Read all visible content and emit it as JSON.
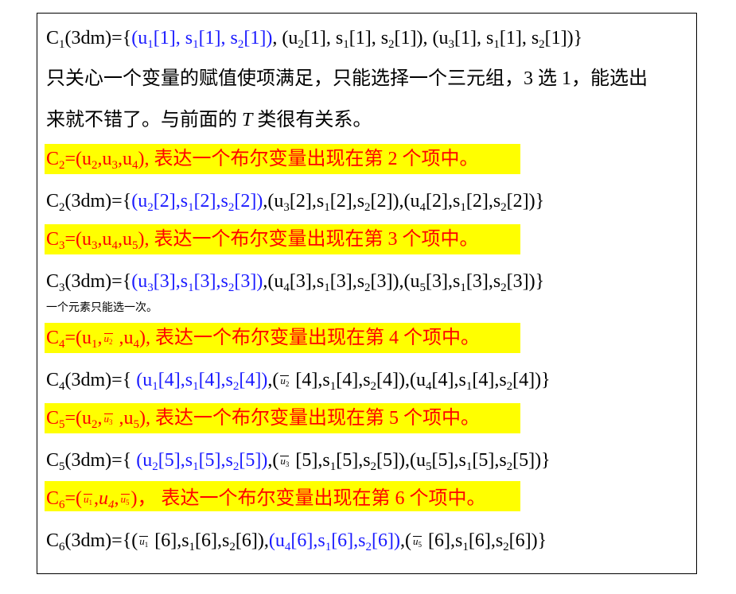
{
  "lines": {
    "l1": {
      "p0": "C",
      "s0": "1",
      "p1": "(3dm)={",
      "b1": "(u",
      "bs1": "1",
      "b2": "[1], s",
      "bs2": "1",
      "b3": "[1], s",
      "bs3": "2",
      "b4": "[1])",
      "p2": ", (u",
      "s1": "2",
      "p3": "[1], s",
      "s2": "1",
      "p4": "[1], s",
      "s3": "2",
      "p5": "[1]), (u",
      "s4": "3",
      "p6": "[1], s",
      "s5": "1",
      "p7": "[1], s",
      "s6": "2",
      "p8": "[1])}"
    },
    "l2": "只关心一个变量的赋值使项满足，只能选择一个三元组，3 选 1，能选出",
    "l3": {
      "a": "来就不错了。与前面的 ",
      "t": "T",
      "b": " 类很有关系。"
    },
    "h2": {
      "a": "C",
      "s0": "2",
      "b": "=(u",
      "s1": "2",
      "c": ",u",
      "s2": "3",
      "d": ",u",
      "s3": "4",
      "e": "),  表达一个布尔变量出现在第 2 个项中。"
    },
    "c2": {
      "a": "C",
      "s0": "2",
      "b": "(3dm)={",
      "b1": "(u",
      "bs1": "2",
      "b2": "[2],s",
      "bs2": "1",
      "b3": "[2],s",
      "bs3": "2",
      "b4": "[2])",
      "c": ",(u",
      "s1": "3",
      "d": "[2],s",
      "s2": "1",
      "e": "[2],s",
      "s3": "2",
      "f": "[2]),(u",
      "s4": "4",
      "g": "[2],s",
      "s5": "1",
      "h": "[2],s",
      "s6": "2",
      "i": "[2])}"
    },
    "h3": {
      "a": "C",
      "s0": "3",
      "b": "=(u",
      "s1": "3",
      "c": ",u",
      "s2": "4",
      "d": ",u",
      "s3": "5",
      "e": "),  表达一个布尔变量出现在第 3 个项中。"
    },
    "c3": {
      "a": "C",
      "s0": "3",
      "b": "(3dm)={",
      "b1": "(u",
      "bs1": "3",
      "b2": "[3],s",
      "bs2": "1",
      "b3": "[3],s",
      "bs3": "2",
      "b4": "[3])",
      "c": ",(u",
      "s1": "4",
      "d": "[3],s",
      "s2": "1",
      "e": "[3],s",
      "s3": "2",
      "f": "[3]),(u",
      "s4": "5",
      "g": "[3],s",
      "s5": "1",
      "h": "[3],s",
      "s6": "2",
      "i": "[3])}"
    },
    "note": "一个元素只能选一次。",
    "h4": {
      "a": "C",
      "s0": "4",
      "b": "=(u",
      "s1": "1",
      "c": ",",
      "u": "u",
      "us": "2",
      "d": " ,u",
      "s3": "4",
      "e": "),  表达一个布尔变量出现在第 4 个项中。"
    },
    "c4": {
      "a": "C",
      "s0": "4",
      "b": "(3dm)={ ",
      "b1": "(u",
      "bs1": "1",
      "b2": "[4],s",
      "bs2": "1",
      "b3": "[4],s",
      "bs3": "2",
      "b4": "[4])",
      "c": ",(",
      "u": "u",
      "us": "2",
      "d": " [4],s",
      "s2": "1",
      "e": "[4],s",
      "s3": "2",
      "f": "[4]),(u",
      "s4": "4",
      "g": "[4],s",
      "s5": "1",
      "h": "[4],s",
      "s6": "2",
      "i": "[4])}"
    },
    "h5": {
      "a": "C",
      "s0": "5",
      "b": "=(u",
      "s1": "2",
      "c": ",",
      "u": "u",
      "us": "3",
      "d": " ,u",
      "s3": "5",
      "e": "),  表达一个布尔变量出现在第 5 个项中。"
    },
    "c5": {
      "a": "C",
      "s0": "5",
      "b": "(3dm)={ ",
      "b1": "(u",
      "bs1": "2",
      "b2": "[5],s",
      "bs2": "1",
      "b3": "[5],s",
      "bs3": "2",
      "b4": "[5])",
      "c": ",(",
      "u": "u",
      "us": "3",
      "d": " [5],s",
      "s2": "1",
      "e": "[5],s",
      "s3": "2",
      "f": "[5]),(u",
      "s4": "5",
      "g": "[5],s",
      "s5": "1",
      "h": "[5],s",
      "s6": "2",
      "i": "[5])}"
    },
    "h6": {
      "a": "C",
      "s0": "6",
      "b": "=(",
      "u1": "u",
      "us1": "1",
      "c": ",",
      "u4": "u",
      "u4s": "4",
      "d": ",",
      "u5": "u",
      "us5": "5",
      "e": ")，  表达一个布尔变量出现在第 6 个项中。"
    },
    "c6": {
      "a": "C",
      "s0": "6",
      "b": "(3dm)={(",
      "u": "u",
      "us": "1",
      "c": " [6],s",
      "s1": "1",
      "d": "[6],s",
      "s2": "2",
      "e": "[6]),",
      "b1": "(u",
      "bs1": "4",
      "b2": "[6],s",
      "bs2": "1",
      "b3": "[6],s",
      "bs3": "2",
      "b4": "[6])",
      "f": ",(",
      "u2": "u",
      "us2": "5",
      "g": " [6],s",
      "s5": "1",
      "h": "[6],s",
      "s6": "2",
      "i": "[6])}"
    }
  },
  "colors": {
    "highlight": "#ffff00",
    "red": "#ff0000",
    "blue": "#1a1aff",
    "text": "#000000"
  }
}
